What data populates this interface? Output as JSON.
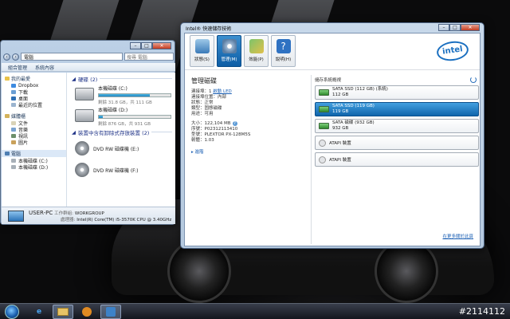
{
  "explorer": {
    "address": "電腦",
    "search_placeholder": "搜尋 電腦",
    "toolbar": [
      "組合管理",
      "系統內容"
    ],
    "nav": {
      "favorites_header": "我的最愛",
      "favorites": [
        "Dropbox",
        "下載",
        "桌面",
        "最近的位置"
      ],
      "libraries_header": "媒體櫃",
      "libraries": [
        "文件",
        "音樂",
        "視訊",
        "圖片"
      ],
      "computer_header": "電腦",
      "drives": [
        "本機磁碟 (C:)",
        "本機磁碟 (D:)"
      ]
    },
    "hard_disks": {
      "header": "硬碟 (2)",
      "items": [
        {
          "name": "本機磁碟 (C:)",
          "free": "剩餘 31.8 GB，共 111 GB",
          "used_fraction": 0.71
        },
        {
          "name": "本機磁碟 (D:)",
          "free": "剩餘 876 GB，共 931 GB",
          "used_fraction": 0.06
        }
      ]
    },
    "removable": {
      "header": "裝置中含有卸除式存放裝置 (2)",
      "items": [
        "DVD RW 磁碟機 (E:)",
        "DVD RW 磁碟機 (F:)"
      ]
    },
    "details": {
      "pc_name": "USER-PC",
      "workgroup_label": "工作群組:",
      "workgroup": "WORKGROUP",
      "processor_label": "處理器:",
      "processor": "Intel(R) Core(TM) i5-3570K CPU @ 3.40GHz"
    }
  },
  "intel": {
    "title": "Intel® 快速儲存技術",
    "nav": [
      {
        "label": "狀態(S)",
        "active": false
      },
      {
        "label": "管理(M)",
        "active": true
      },
      {
        "label": "效能(P)",
        "active": false
      },
      {
        "label": "說明(H)",
        "active": false
      }
    ],
    "logo": "intel",
    "detail": {
      "title": "管理磁碟",
      "port": "連接埠：1",
      "port_link": "啟動 LED",
      "port_location": "連接埠位置：內部",
      "status": "狀態：正常",
      "type": "類型：固態磁碟",
      "usage": "用途：可用",
      "size": "大小：122,104 MB",
      "serial": "序號：P02312113410",
      "model": "型號：PLEXTOR PX-128M5S",
      "firmware": "韌體：1.03",
      "more": "進階"
    },
    "system_view": {
      "header": "儲存系統概視",
      "devices": [
        {
          "l1": "SATA SSD (112 GB) (系統)",
          "l2": "112 GB",
          "selected": false,
          "kind": "ssd"
        },
        {
          "l1": "SATA SSD (119 GB)",
          "l2": "119 GB",
          "selected": true,
          "kind": "ssd"
        },
        {
          "l1": "SATA 磁碟 (932 GB)",
          "l2": "932 GB",
          "selected": false,
          "kind": "hdd"
        },
        {
          "l1": "ATAPI 裝置",
          "l2": "",
          "selected": false,
          "kind": "atapi"
        },
        {
          "l1": "ATAPI 裝置",
          "l2": "",
          "selected": false,
          "kind": "atapi"
        }
      ]
    },
    "footer_link": "在更多關於此頁"
  },
  "taskbar": {
    "items": [
      "internet-explorer",
      "file-explorer",
      "media-player",
      "intel-rst"
    ]
  },
  "watermark": "#2114112"
}
